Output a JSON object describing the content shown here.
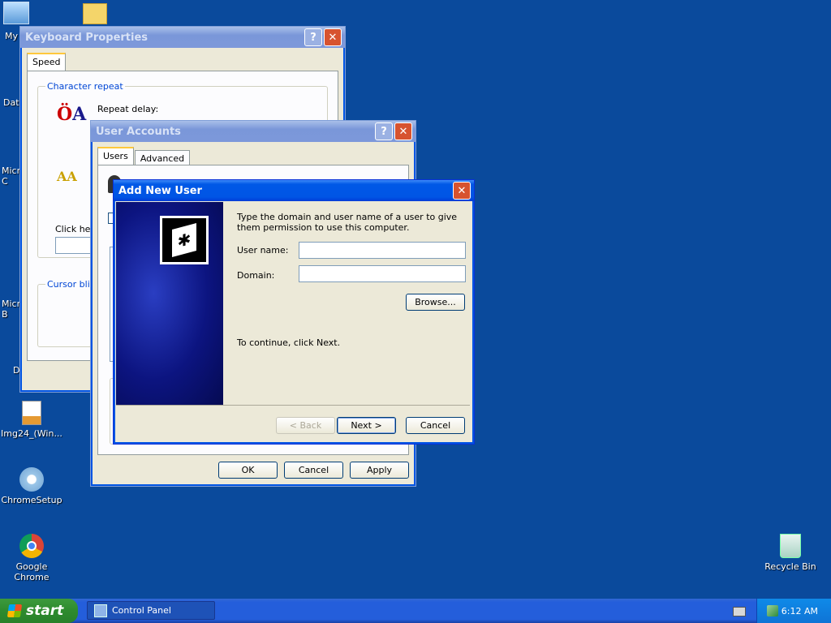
{
  "desktop": {
    "icons": [
      {
        "label": "My"
      },
      {
        "label": "Dat"
      },
      {
        "label": "Micro C"
      },
      {
        "label": "Micro B"
      },
      {
        "label": "D"
      },
      {
        "label": "Img24_(Win..."
      },
      {
        "label": "ChromeSetup"
      },
      {
        "label": "Google Chrome"
      },
      {
        "label": "Recycle Bin"
      }
    ]
  },
  "keyboard_window": {
    "title": "Keyboard Properties",
    "help": "?",
    "close": "✕",
    "tab": "Speed",
    "group1": "Character repeat",
    "repeat_delay": "Repeat delay:",
    "click_here": "Click here",
    "group2": "Cursor blink"
  },
  "user_accounts": {
    "title": "User Accounts",
    "help": "?",
    "close": "✕",
    "tabs": [
      "Users",
      "Advanced"
    ],
    "ok": "OK",
    "cancel": "Cancel",
    "apply": "Apply"
  },
  "add_user": {
    "title": "Add New User",
    "close": "✕",
    "instruction": "Type the domain and user name of a user to give them permission to use this computer.",
    "username_label": "User name:",
    "username_value": "",
    "domain_label": "Domain:",
    "domain_value": "",
    "browse": "Browse...",
    "continue_text": "To continue, click Next.",
    "back": "< Back",
    "next": "Next >",
    "cancel": "Cancel"
  },
  "taskbar": {
    "start": "start",
    "task": "Control Panel",
    "time": "6:12 AM"
  },
  "colors": {
    "desktop": "#0a4a9c",
    "title_active": "#0058e6",
    "dialog_bg": "#ece9d8"
  }
}
